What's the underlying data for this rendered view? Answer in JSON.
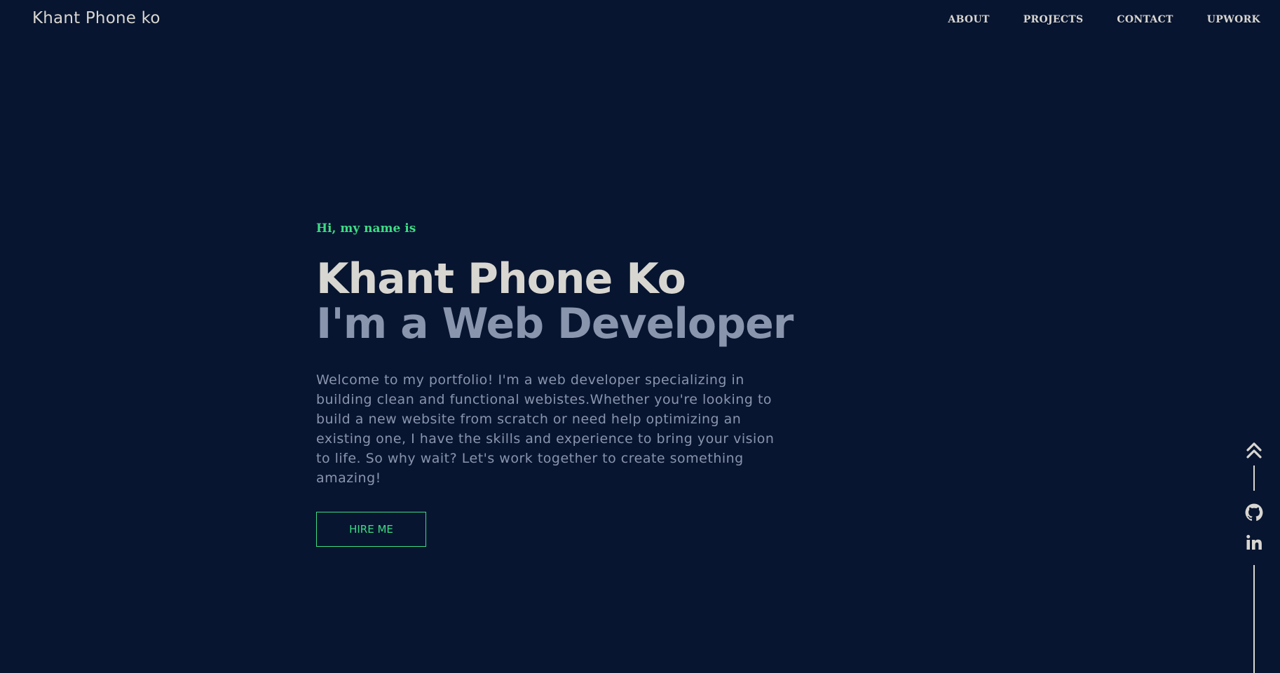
{
  "header": {
    "brand": "Khant Phone ko",
    "nav": [
      {
        "label": "ABOUT"
      },
      {
        "label": "PROJECTS"
      },
      {
        "label": "CONTACT"
      },
      {
        "label": "UPWORK"
      }
    ]
  },
  "hero": {
    "greeting": "Hi, my name is",
    "name": "Khant Phone Ko",
    "role": "I'm a Web Developer",
    "bio": "Welcome to my portfolio! I'm a web developer specializing in building clean and functional webistes.Whether you're looking to build a new website from scratch or need help optimizing an existing one, I have the skills and experience to bring your vision to life. So why wait? Let's work together to create something amazing!",
    "cta_label": "HIRE ME"
  },
  "social": {
    "icons": [
      "chevron-double-up-icon",
      "github-icon",
      "linkedin-icon"
    ]
  },
  "colors": {
    "background": "#081530",
    "accent": "#3ddc84",
    "text_primary": "#d8d6d0",
    "text_secondary": "#8994ad"
  }
}
